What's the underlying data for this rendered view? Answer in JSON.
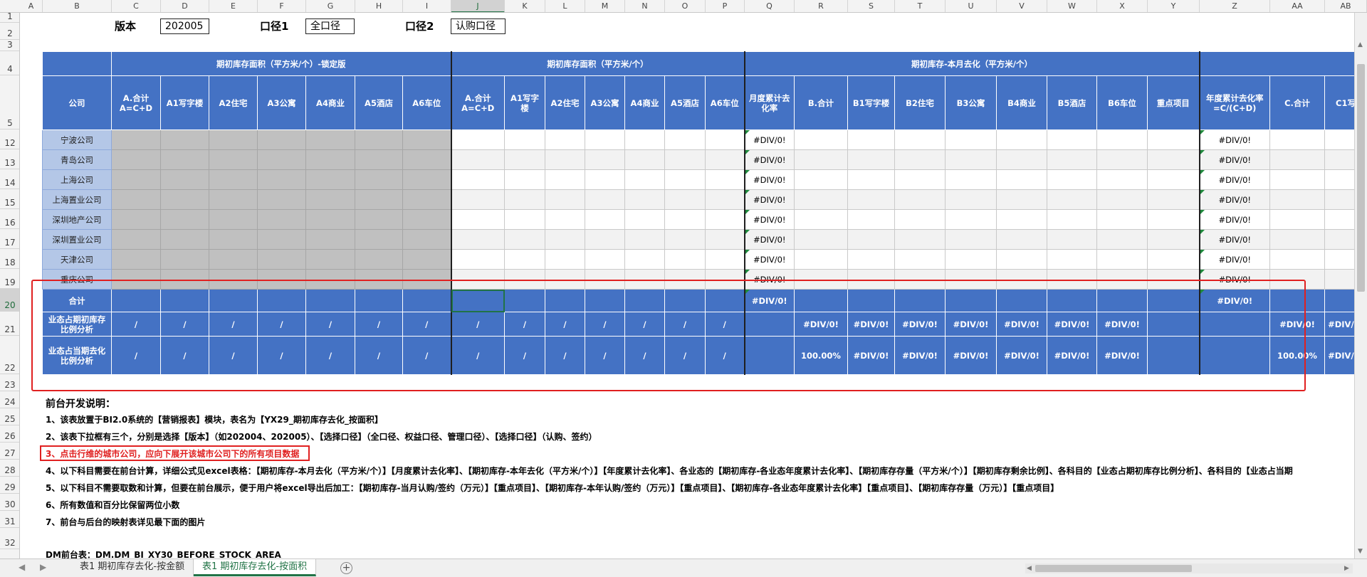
{
  "columns": [
    "A",
    "B",
    "C",
    "D",
    "E",
    "F",
    "G",
    "H",
    "I",
    "J",
    "K",
    "L",
    "M",
    "N",
    "O",
    "P",
    "Q",
    "R",
    "S",
    "T",
    "U",
    "V",
    "W",
    "X",
    "Y",
    "Z",
    "AA",
    "AB"
  ],
  "selected_column": "J",
  "row_numbers": [
    "1",
    "2",
    "3",
    "4",
    "5",
    "12",
    "13",
    "14",
    "15",
    "16",
    "17",
    "18",
    "19",
    "20",
    "21",
    "22",
    "23",
    "24",
    "25",
    "26",
    "27",
    "28",
    "29",
    "30",
    "31",
    "32"
  ],
  "selected_row": "20",
  "top_fields": {
    "version_label": "版本",
    "version_value": "202005",
    "scope1_label": "口径1",
    "scope1_value": "全口径",
    "scope2_label": "口径2",
    "scope2_value": "认购口径"
  },
  "header_groups": [
    "期初库存面积（平方米/个）-锁定版",
    "期初库存面积（平方米/个）",
    "期初库存-本月去化（平方米/个）"
  ],
  "sub_headers": {
    "company": "公司",
    "group1": [
      "A.合计\nA=C+D",
      "A1写字楼",
      "A2住宅",
      "A3公寓",
      "A4商业",
      "A5酒店",
      "A6车位"
    ],
    "group2": [
      "A.合计\nA=C+D",
      "A1写字\n楼",
      "A2住宅",
      "A3公寓",
      "A4商业",
      "A5酒店",
      "A6车位"
    ],
    "group3": [
      "月度累计去\n化率",
      "B.合计",
      "B1写字楼",
      "B2住宅",
      "B3公寓",
      "B4商业",
      "B5酒店",
      "B6车位",
      "重点项目"
    ],
    "group4": [
      "年度累计去化率\n=C/(C+D)",
      "C.合计",
      "C1写"
    ]
  },
  "companies": [
    "宁波公司",
    "青岛公司",
    "上海公司",
    "上海置业公司",
    "深圳地产公司",
    "深圳置业公司",
    "天津公司",
    "重庆公司"
  ],
  "div_error": "#DIV/0!",
  "summary_rows": {
    "total_label": "合计",
    "ratio_start_label": "业态占期初库存\n比例分析",
    "ratio_period_label": "业态占当期去化\n比例分析",
    "slash": "/",
    "pct_100": "100.00%",
    "pct_100_partial": "100.00%",
    "div_partial": "#DIV/0!"
  },
  "notes": {
    "title": "前台开发说明：",
    "items": [
      "1、该表放置于BI2.0系统的【营销报表】模块，表名为【YX29_期初库存去化_按面积】",
      "2、该表下拉框有三个，分别是选择【版本】（如202004、202005）、【选择口径】（全口径、权益口径、管理口径）、【选择口径】（认购、签约）",
      "3、点击行维的城市公司，应向下展开该城市公司下的所有项目数据",
      "4、以下科目需要在前台计算，详细公式见excel表格：【期初库存-本月去化（平方米/个）】【月度累计去化率】、【期初库存-本年去化（平方米/个）】【年度累计去化率】、各业态的【期初库存-各业态年度累计去化率】、【期初库存存量（平方米/个）】【期初库存剩余比例】、各科目的【业态占期初库存比例分析】、各科目的【业态占当期",
      "5、以下科目不需要取数和计算，但要在前台展示，便于用户将excel导出后加工：【期初库存-当月认购/签约（万元）】【重点项目】、【期初库存-本年认购/签约（万元）】【重点项目】、【期初库存-各业态年度累计去化率】【重点项目】、【期初库存存量（万元）】【重点项目】",
      "6、所有数值和百分比保留两位小数",
      "7、前台与后台的映射表详见最下面的图片"
    ],
    "dm_label": "DM前台表：DM.DM_BI_XY30_BEFORE_STOCK_AREA"
  },
  "sheet_tabs": [
    "表1 期初库存去化-按金额",
    "表1 期初库存去化-按面积"
  ],
  "active_sheet_index": 1,
  "icons": {
    "add_sheet": "plus-circle-icon",
    "nav_prev": "triangle-left-icon",
    "nav_next": "triangle-right-icon",
    "scroll_up": "triangle-up-icon",
    "scroll_down": "triangle-down-icon"
  }
}
